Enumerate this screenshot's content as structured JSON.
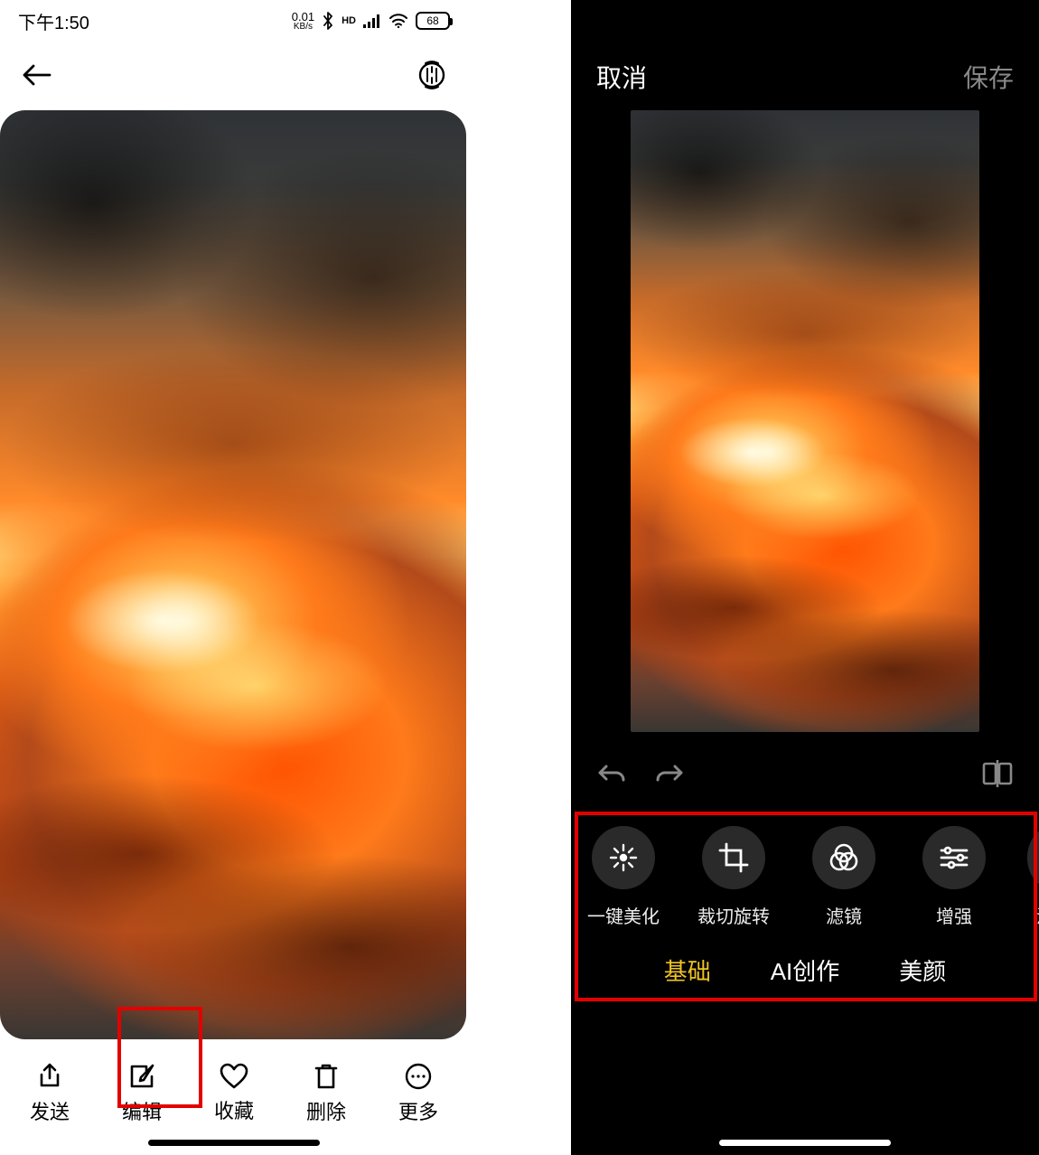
{
  "left": {
    "status": {
      "time": "下午1:50",
      "kbps_value": "0.01",
      "kbps_unit": "KB/s",
      "hd": "HD",
      "battery": "68"
    },
    "actions": {
      "send": "发送",
      "edit": "编辑",
      "favorite": "收藏",
      "delete": "删除",
      "more": "更多"
    }
  },
  "right": {
    "header": {
      "cancel": "取消",
      "save": "保存"
    },
    "tools": {
      "auto_enhance": "一键美化",
      "crop_rotate": "裁切旋转",
      "filter": "滤镜",
      "adjust": "增强",
      "doodle": "涂鸦"
    },
    "tabs": {
      "basic": "基础",
      "ai": "AI创作",
      "beauty": "美颜"
    }
  }
}
